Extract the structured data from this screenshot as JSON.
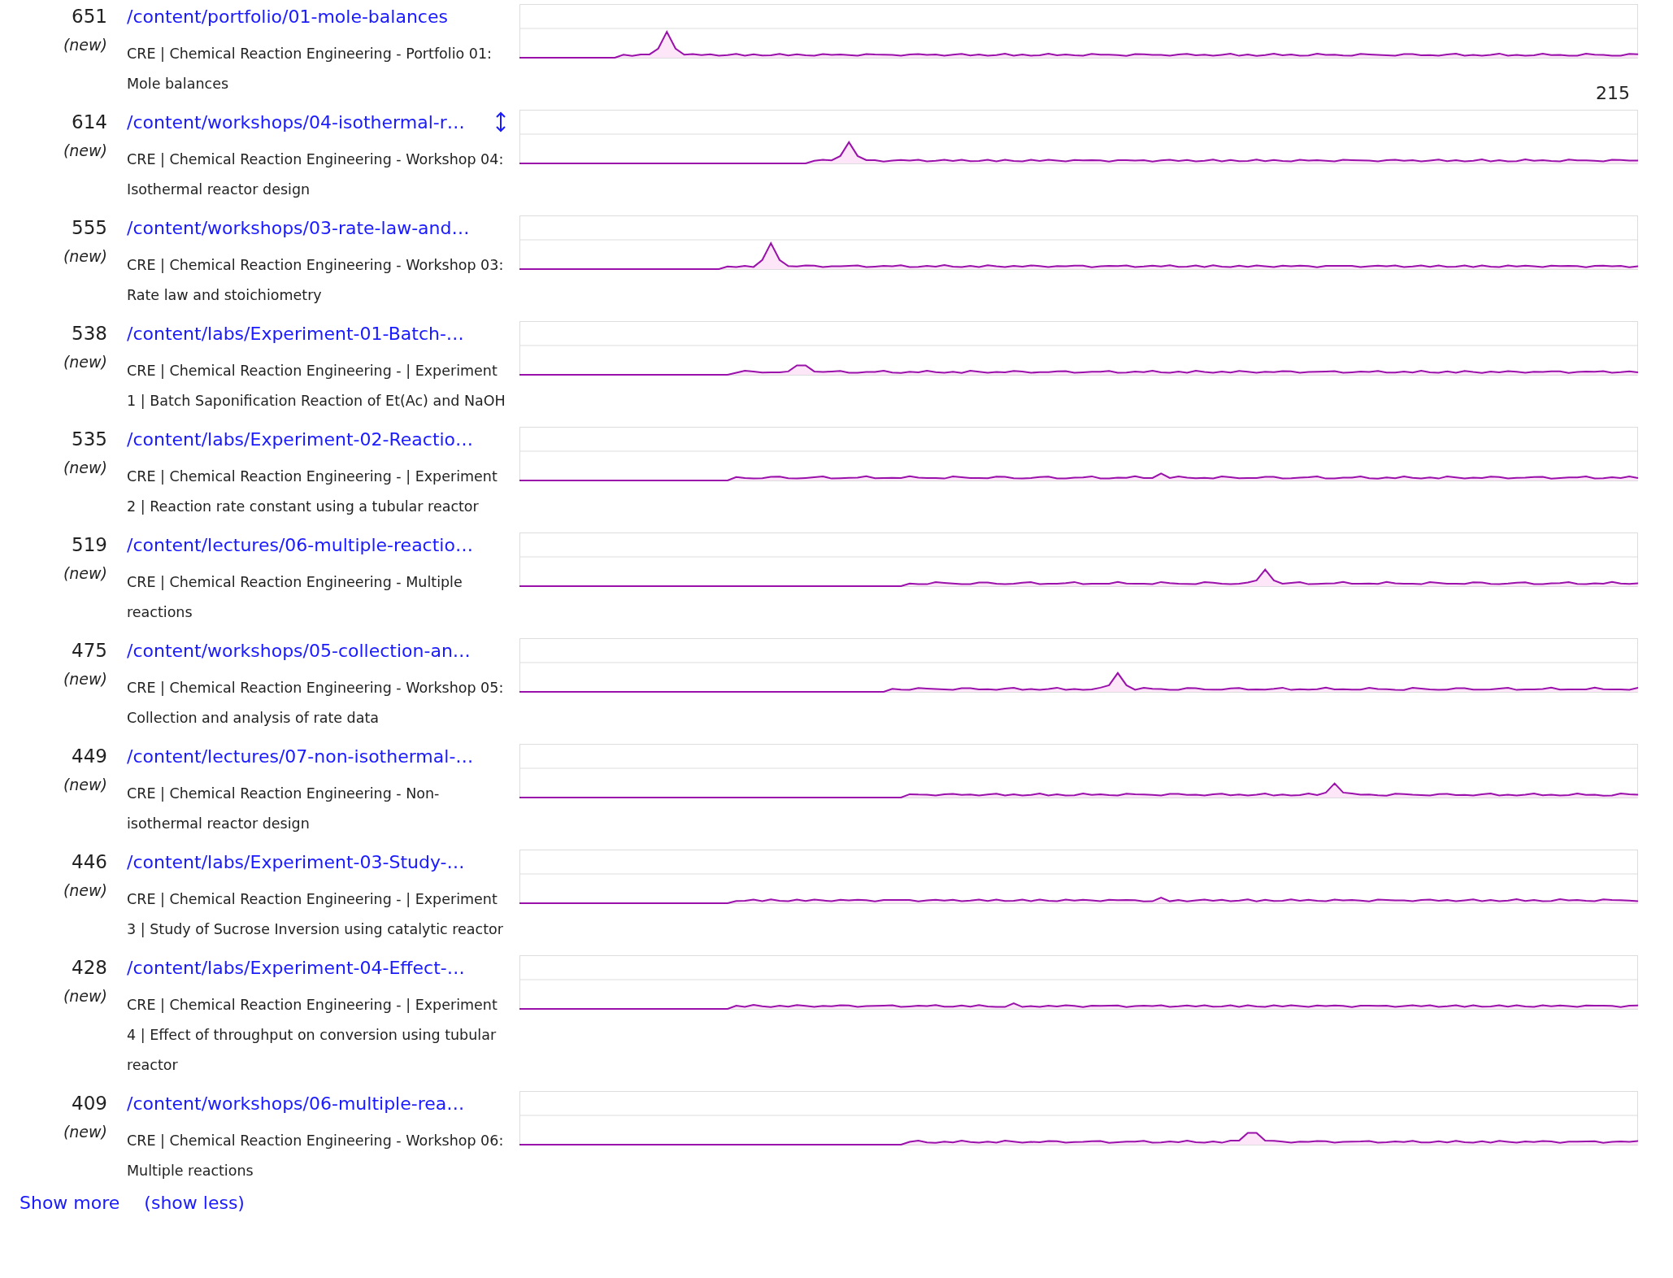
{
  "pages": [
    {
      "count": "651",
      "new_label": "(new)",
      "path": "/content/portfolio/01-mole-balances",
      "title": "CRE | Chemical Reaction Engineering - Portfolio 01: Mole balances",
      "hovered": false
    },
    {
      "count": "614",
      "new_label": "(new)",
      "path": "/content/workshops/04-isothermal-r…",
      "title": "CRE | Chemical Reaction Engineering - Workshop 04: Isothermal reactor design",
      "hovered": true,
      "max": "215"
    },
    {
      "count": "555",
      "new_label": "(new)",
      "path": "/content/workshops/03-rate-law-and…",
      "title": "CRE | Chemical Reaction Engineering - Workshop 03: Rate law and stoichiometry",
      "hovered": false
    },
    {
      "count": "538",
      "new_label": "(new)",
      "path": "/content/labs/Experiment-01-Batch-…",
      "title": "CRE | Chemical Reaction Engineering - | Experiment 1 | Batch Saponification Reaction of Et(Ac) and NaOH",
      "hovered": false
    },
    {
      "count": "535",
      "new_label": "(new)",
      "path": "/content/labs/Experiment-02-Reactio…",
      "title": "CRE | Chemical Reaction Engineering - | Experiment 2 | Reaction rate constant using a tubular reactor",
      "hovered": false
    },
    {
      "count": "519",
      "new_label": "(new)",
      "path": "/content/lectures/06-multiple-reactio…",
      "title": "CRE | Chemical Reaction Engineering - Multiple reactions",
      "hovered": false
    },
    {
      "count": "475",
      "new_label": "(new)",
      "path": "/content/workshops/05-collection-an…",
      "title": "CRE | Chemical Reaction Engineering - Workshop 05: Collection and analysis of rate data",
      "hovered": false
    },
    {
      "count": "449",
      "new_label": "(new)",
      "path": "/content/lectures/07-non-isothermal-…",
      "title": "CRE | Chemical Reaction Engineering - Non-isothermal reactor design",
      "hovered": false
    },
    {
      "count": "446",
      "new_label": "(new)",
      "path": "/content/labs/Experiment-03-Study-…",
      "title": "CRE | Chemical Reaction Engineering - | Experiment 3 | Study of Sucrose Inversion using catalytic reactor",
      "hovered": false
    },
    {
      "count": "428",
      "new_label": "(new)",
      "path": "/content/labs/Experiment-04-Effect-…",
      "title": "CRE | Chemical Reaction Engineering - | Experiment 4 | Effect of throughput on conversion using tubular reactor",
      "hovered": false
    },
    {
      "count": "409",
      "new_label": "(new)",
      "path": "/content/workshops/06-multiple-rea…",
      "title": "CRE | Chemical Reaction Engineering - Workshop 06: Multiple reactions",
      "hovered": false
    }
  ],
  "show_more": "Show more",
  "show_less": "(show less)"
}
